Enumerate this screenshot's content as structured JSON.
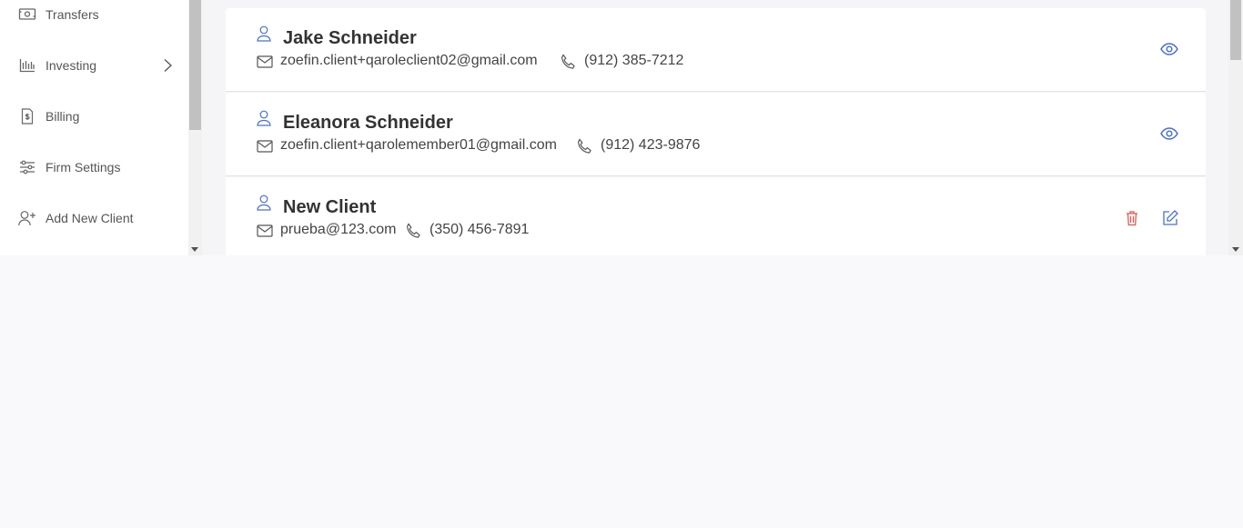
{
  "sidebar": {
    "items": [
      {
        "label": "Transfers",
        "icon": "money-icon"
      },
      {
        "label": "Investing",
        "icon": "chart-icon"
      },
      {
        "label": "Billing",
        "icon": "document-dollar-icon"
      },
      {
        "label": "Firm Settings",
        "icon": "sliders-icon"
      },
      {
        "label": "Add New Client",
        "icon": "add-user-icon"
      }
    ]
  },
  "clients": [
    {
      "name": "Jake Schneider",
      "email": "zoefin.client+qaroleclient02@gmail.com",
      "phone": "(912) 385-7212",
      "actions": [
        "view"
      ]
    },
    {
      "name": "Eleanora Schneider",
      "email": "zoefin.client+qarolemember01@gmail.com",
      "phone": "(912) 423-9876",
      "actions": [
        "view"
      ]
    },
    {
      "name": "New Client",
      "email": "prueba@123.com",
      "phone": "(350) 456-7891",
      "actions": [
        "delete",
        "edit"
      ]
    }
  ],
  "colors": {
    "accent": "#4a6fd1",
    "danger": "#e05a4f",
    "icon_gray": "#666666"
  }
}
